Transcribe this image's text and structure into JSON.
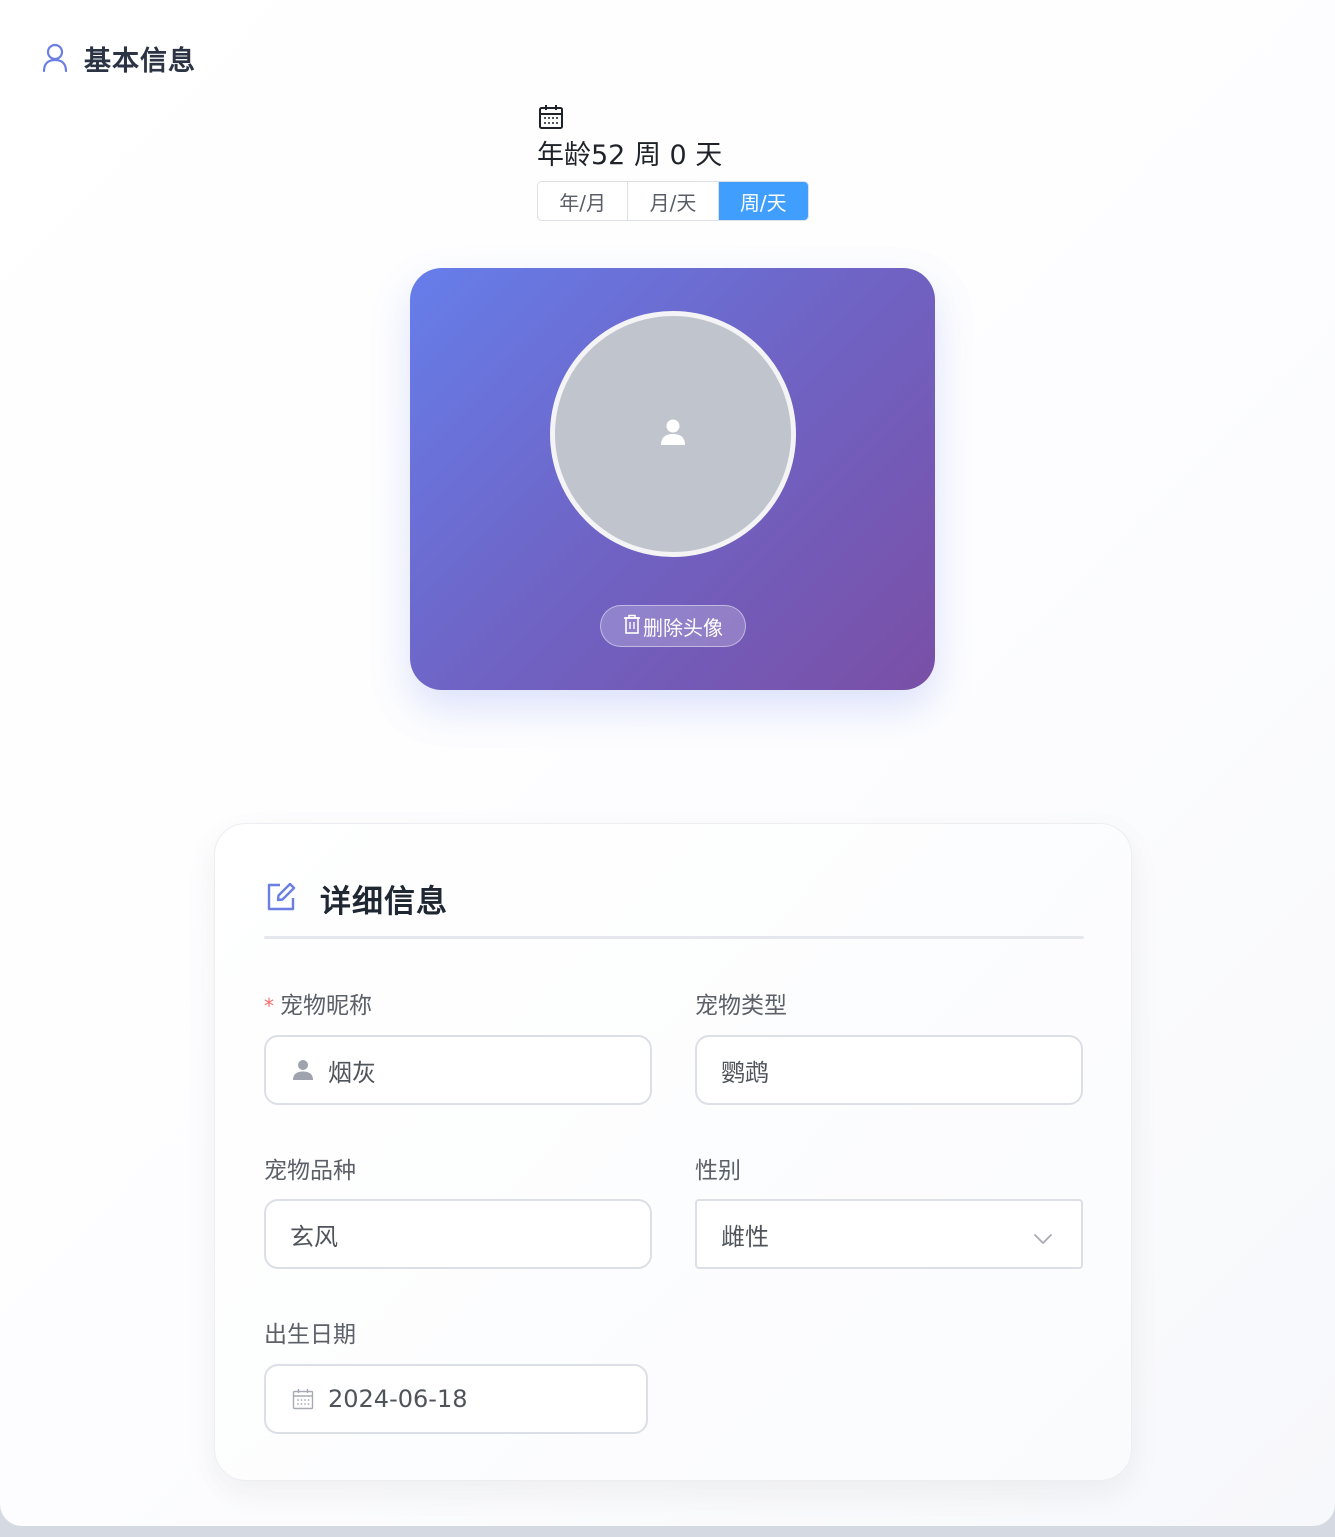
{
  "basic_info": {
    "title": "基本信息",
    "icon": "user-icon"
  },
  "age": {
    "icon": "calendar-icon",
    "label": "年龄52 周 0 天",
    "toggle_options": [
      "年/月",
      "月/天",
      "周/天"
    ],
    "active_option": "周/天"
  },
  "avatar_card": {
    "gradient_start": "#667eea",
    "gradient_end": "#764ba2",
    "placeholder_icon": "user-placeholder-icon",
    "delete_button": "删除头像",
    "delete_icon": "trash-icon"
  },
  "details": {
    "title": "详细信息",
    "icon": "edit-icon",
    "fields": {
      "nickname": {
        "label": "宠物昵称",
        "required_mark": "*",
        "value": "烟灰",
        "icon": "user-icon"
      },
      "type": {
        "label": "宠物类型",
        "value": "鹦鹉"
      },
      "breed": {
        "label": "宠物品种",
        "value": "玄风"
      },
      "gender": {
        "label": "性别",
        "value": "雌性",
        "icon": "chevron-down-icon"
      },
      "birth_date": {
        "label": "出生日期",
        "value": "2024-06-18",
        "icon": "calendar-icon"
      }
    }
  },
  "colors": {
    "accent": "#409eff",
    "required": "#f56c6c",
    "title_text": "#2b3345",
    "border": "#dcdfe6"
  }
}
